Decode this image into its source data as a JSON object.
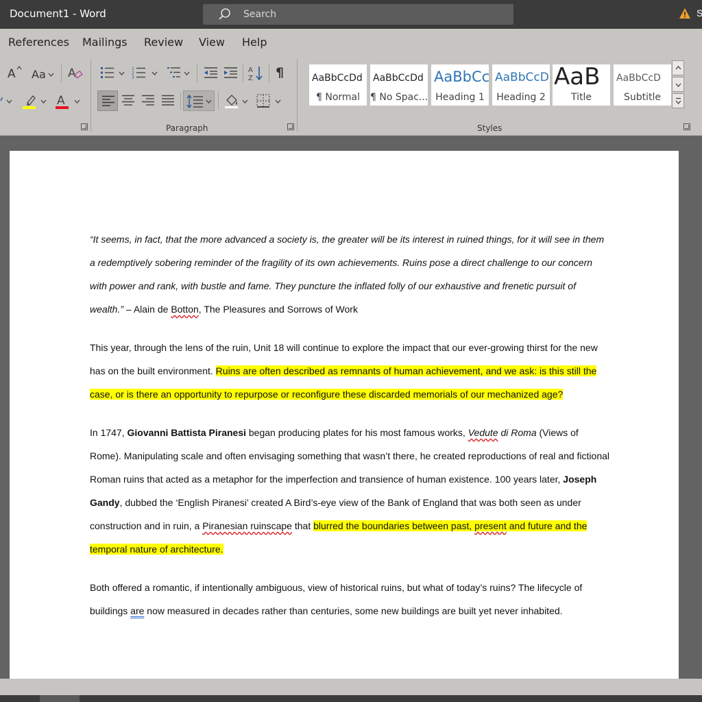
{
  "titlebar": {
    "title": "Document1  -  Word",
    "search_placeholder": "Search",
    "warning_partial": "S"
  },
  "tabs": [
    "References",
    "Mailings",
    "Review",
    "View",
    "Help"
  ],
  "ribbon": {
    "font_size_up": "A",
    "change_case": "Aa",
    "font_color_glyph": "A",
    "sort_glyph": "A↓",
    "pilcrow": "¶",
    "paragraph_label": "Paragraph",
    "styles_label": "Styles",
    "styles": [
      {
        "preview": "AaBbCcDd",
        "name": "¶ Normal"
      },
      {
        "preview": "AaBbCcDd",
        "name": "¶ No Spac..."
      },
      {
        "preview": "AaBbCc",
        "name": "Heading 1"
      },
      {
        "preview": "AaBbCcD",
        "name": "Heading 2"
      },
      {
        "preview": "AaB",
        "name": "Title"
      },
      {
        "preview": "AaBbCcD",
        "name": "Subtitle"
      }
    ]
  },
  "document": {
    "quote": "“It seems, in fact, that the more advanced a society is, the greater will be its interest in ruined things, for it will see in them a redemptively sobering reminder of the fragility of its own achievements. Ruins pose a direct challenge to our concern with power and rank, with bustle and fame. They puncture the inflated folly of our exhaustive and frenetic pursuit of wealth.”",
    "quote_attr_1": " – Alain de ",
    "quote_attr_name": "Botton",
    "quote_attr_2": ", The Pleasures and Sorrows of Work",
    "p1_plain": "This year, through the lens of the ruin, Unit 18 will continue to explore the impact that our ever-growing thirst for the new has on the built environment. ",
    "p1_highlight": "Ruins are often described as remnants of human achievement, and we ask: is this still the case, or is there an opportunity to repurpose or reconfigure these discarded memorials of our mechanized age?",
    "p2_a": "In 1747, ",
    "p2_b_bold": "Giovanni Battista Piranesi",
    "p2_c": " began producing plates for his most famous works, ",
    "p2_d_sq": "Vedute",
    "p2_e_it": " di Roma",
    "p2_f": " (Views of Rome). Manipulating scale and often envisaging something that wasn’t there, he created reproductions of real and fictional Roman ruins that acted as a metaphor for the imperfection and transience of human existence. 100 years later, ",
    "p2_g_bold": "Joseph Gandy",
    "p2_h": ", dubbed the ‘English Piranesi’ created A Bird’s-eye view of the Bank of England that was both seen as under construction and in ruin, a ",
    "p2_i_sq": "Piranesian ruinscape",
    "p2_j": " that ",
    "p2_k_hl1": "blurred the boundaries between past, ",
    "p2_k_hl_sq": "present",
    "p2_k_hl2": " and future and the temporal nature of architecture.",
    "p3_a": "Both offered a romantic, if intentionally ambiguous, view of historical ruins, but what of today’s ruins? The lifecycle of buildings ",
    "p3_b_gq": "are",
    "p3_c": " now measured in decades rather than centuries, some new buildings are built yet never inhabited."
  },
  "colors": {
    "highlight": "#ffff00",
    "font_color_bar": "#e81123",
    "highlight_bar": "#ffff00",
    "accent": "#2b579a"
  }
}
